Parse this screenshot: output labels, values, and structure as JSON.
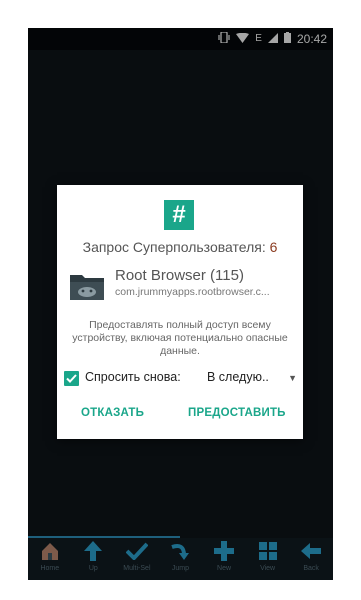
{
  "status_bar": {
    "time": "20:42"
  },
  "dialog": {
    "title": "Запрос Суперпользователя:",
    "request_count": "6",
    "app_name": "Root Browser (115)",
    "package": "com.jrummyapps.rootbrowser.c...",
    "description": "Предоставлять полный доступ всему устройству, включая потенциально опасные данные.",
    "ask_again_label": "Спросить снова:",
    "ask_again_checked": true,
    "duration_value": "В следую..",
    "deny_label": "ОТКАЗАТЬ",
    "grant_label": "ПРЕДОСТАВИТЬ"
  },
  "toolbar": {
    "items": [
      {
        "label": "Home",
        "icon": "home-icon"
      },
      {
        "label": "Up",
        "icon": "up-arrow-icon"
      },
      {
        "label": "Multi-Sel",
        "icon": "check-icon"
      },
      {
        "label": "Jump",
        "icon": "jump-arrow-icon"
      },
      {
        "label": "New",
        "icon": "plus-icon"
      },
      {
        "label": "View",
        "icon": "grid-icon"
      },
      {
        "label": "Back",
        "icon": "back-arrow-icon"
      }
    ]
  },
  "colors": {
    "accent": "#1aa68a",
    "count": "#8b3b20",
    "background": "#0e1519"
  }
}
